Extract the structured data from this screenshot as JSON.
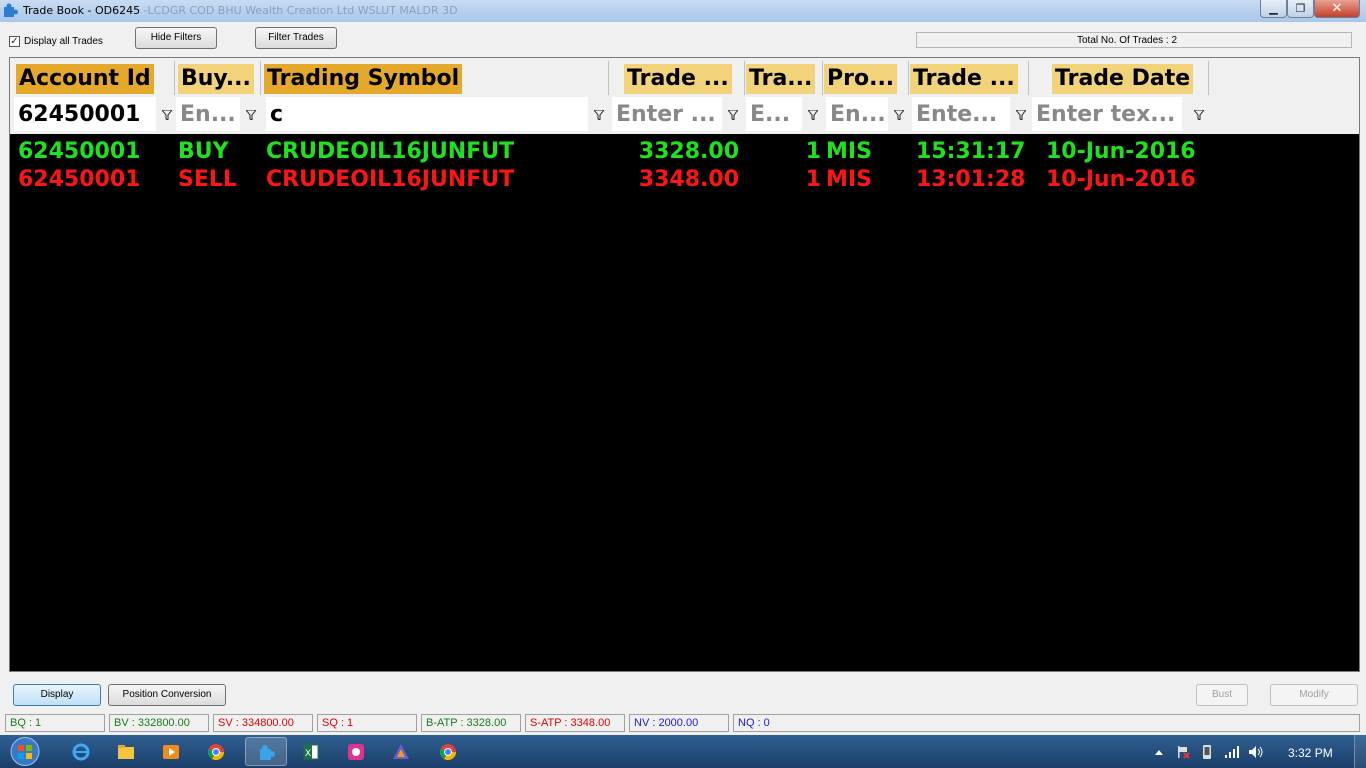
{
  "window": {
    "title": "Trade Book - OD6245",
    "title_obscured": "-LCDGR  COD   BHU Wealth Creation Ltd  WSLUT  MALDR  3D"
  },
  "toolbar": {
    "display_all_checked": true,
    "display_all_label": "Display all Trades",
    "hide_filters_label": "Hide Filters",
    "filter_trades_label": "Filter Trades",
    "total_trades_label": "Total No. Of Trades : 2"
  },
  "grid": {
    "columns": [
      {
        "header": "Account Id",
        "filter": "62450001",
        "filter_has_value": true
      },
      {
        "header": "Buy...",
        "filter": "En...",
        "filter_has_value": false
      },
      {
        "header": "Trading Symbol",
        "filter": "c",
        "filter_has_value": true
      },
      {
        "header": "Trade ...",
        "filter": "Enter ...",
        "filter_has_value": false
      },
      {
        "header": "Tra...",
        "filter": "E...",
        "filter_has_value": false
      },
      {
        "header": "Pro...",
        "filter": "En...",
        "filter_has_value": false
      },
      {
        "header": "Trade ...",
        "filter": "Ente...",
        "filter_has_value": false
      },
      {
        "header": "Trade Date",
        "filter": "Enter tex...",
        "filter_has_value": false
      }
    ],
    "rows": [
      {
        "side": "buy",
        "account": "62450001",
        "buysell": "BUY",
        "symbol": "CRUDEOIL16JUNFUT",
        "price": "3328.00",
        "qty": "1",
        "product": "MIS",
        "time": "15:31:17",
        "date": "10-Jun-2016"
      },
      {
        "side": "sell",
        "account": "62450001",
        "buysell": "SELL",
        "symbol": "CRUDEOIL16JUNFUT",
        "price": "3348.00",
        "qty": "1",
        "product": "MIS",
        "time": "13:01:28",
        "date": "10-Jun-2016"
      }
    ]
  },
  "actions": {
    "display_label": "Display",
    "position_conversion_label": "Position Conversion",
    "bust_label": "Bust",
    "modify_label": "Modify"
  },
  "statusbar": {
    "items": [
      {
        "text": "BQ : 1",
        "color": "#1a7a1a"
      },
      {
        "text": "BV : 332800.00",
        "color": "#1a7a1a"
      },
      {
        "text": "SV : 334800.00",
        "color": "#e00000"
      },
      {
        "text": "SQ : 1",
        "color": "#e00000"
      },
      {
        "text": "B-ATP : 3328.00",
        "color": "#1a7a1a"
      },
      {
        "text": "S-ATP : 3348.00",
        "color": "#e00000"
      },
      {
        "text": "NV : 2000.00",
        "color": "#1a1ad0"
      },
      {
        "text": "NQ : 0",
        "color": "#1a1ad0"
      }
    ]
  },
  "taskbar": {
    "apps": [
      "internet-explorer-icon",
      "file-explorer-icon",
      "media-player-icon",
      "chrome-icon",
      "trading-app-icon",
      "excel-icon",
      "app-icon",
      "prism-app-icon",
      "chrome-icon"
    ],
    "clock": "3:32 PM"
  },
  "colors": {
    "header_dark": "#e4a82b",
    "header_light": "#f2d37a",
    "buy": "#1fe21f",
    "sell": "#ff1414"
  }
}
